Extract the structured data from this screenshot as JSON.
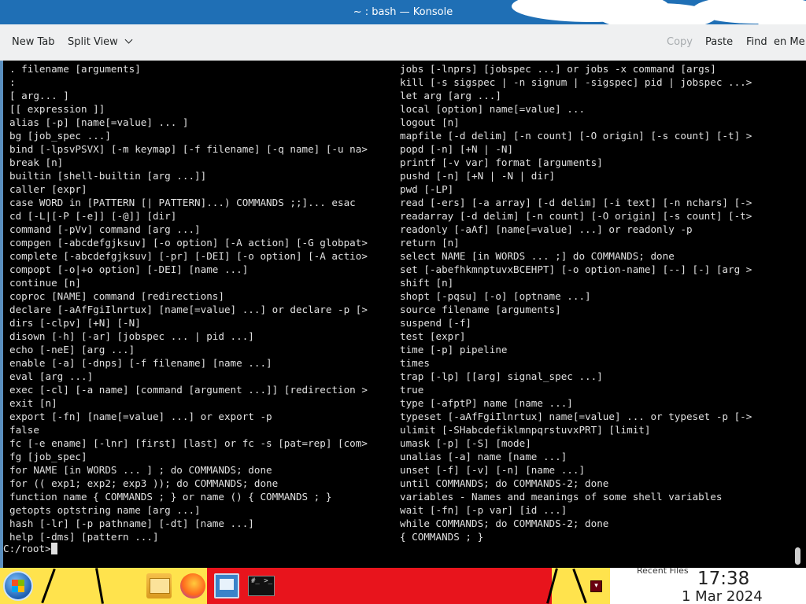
{
  "window": {
    "title": "~ : bash — Konsole"
  },
  "toolbar": {
    "new_tab": "New Tab",
    "split_view": "Split View",
    "copy": "Copy",
    "paste": "Paste",
    "find": "Find",
    "more": "en Me"
  },
  "terminal": {
    "left_column": [
      ". filename [arguments]",
      ":",
      "[ arg... ]",
      "[[ expression ]]",
      "alias [-p] [name[=value] ... ]",
      "bg [job_spec ...]",
      "bind [-lpsvPSVX] [-m keymap] [-f filename] [-q name] [-u na>",
      "break [n]",
      "builtin [shell-builtin [arg ...]]",
      "caller [expr]",
      "case WORD in [PATTERN [| PATTERN]...) COMMANDS ;;]... esac",
      "cd [-L|[-P [-e]] [-@]] [dir]",
      "command [-pVv] command [arg ...]",
      "compgen [-abcdefgjksuv] [-o option] [-A action] [-G globpat>",
      "complete [-abcdefgjksuv] [-pr] [-DEI] [-o option] [-A actio>",
      "compopt [-o|+o option] [-DEI] [name ...]",
      "continue [n]",
      "coproc [NAME] command [redirections]",
      "declare [-aAfFgiIlnrtux] [name[=value] ...] or declare -p [>",
      "dirs [-clpv] [+N] [-N]",
      "disown [-h] [-ar] [jobspec ... | pid ...]",
      "echo [-neE] [arg ...]",
      "enable [-a] [-dnps] [-f filename] [name ...]",
      "eval [arg ...]",
      "exec [-cl] [-a name] [command [argument ...]] [redirection >",
      "exit [n]",
      "export [-fn] [name[=value] ...] or export -p",
      "false",
      "fc [-e ename] [-lnr] [first] [last] or fc -s [pat=rep] [com>",
      "fg [job_spec]",
      "for NAME [in WORDS ... ] ; do COMMANDS; done",
      "for (( exp1; exp2; exp3 )); do COMMANDS; done",
      "function name { COMMANDS ; } or name () { COMMANDS ; }",
      "getopts optstring name [arg ...]",
      "hash [-lr] [-p pathname] [-dt] [name ...]",
      "help [-dms] [pattern ...]"
    ],
    "right_column": [
      "jobs [-lnprs] [jobspec ...] or jobs -x command [args]",
      "kill [-s sigspec | -n signum | -sigspec] pid | jobspec ...>",
      "let arg [arg ...]",
      "local [option] name[=value] ...",
      "logout [n]",
      "mapfile [-d delim] [-n count] [-O origin] [-s count] [-t] >",
      "popd [-n] [+N | -N]",
      "printf [-v var] format [arguments]",
      "pushd [-n] [+N | -N | dir]",
      "pwd [-LP]",
      "read [-ers] [-a array] [-d delim] [-i text] [-n nchars] [->",
      "readarray [-d delim] [-n count] [-O origin] [-s count] [-t>",
      "readonly [-aAf] [name[=value] ...] or readonly -p",
      "return [n]",
      "select NAME [in WORDS ... ;] do COMMANDS; done",
      "set [-abefhkmnptuvxBCEHPT] [-o option-name] [--] [-] [arg >",
      "shift [n]",
      "shopt [-pqsu] [-o] [optname ...]",
      "source filename [arguments]",
      "suspend [-f]",
      "test [expr]",
      "time [-p] pipeline",
      "times",
      "trap [-lp] [[arg] signal_spec ...]",
      "true",
      "type [-afptP] name [name ...]",
      "typeset [-aAfFgiIlnrtux] name[=value] ... or typeset -p [->",
      "ulimit [-SHabcdefiklmnpqrstuvxPRT] [limit]",
      "umask [-p] [-S] [mode]",
      "unalias [-a] name [name ...]",
      "unset [-f] [-v] [-n] [name ...]",
      "until COMMANDS; do COMMANDS-2; done",
      "variables - Names and meanings of some shell variables",
      "wait [-fn] [-p var] [id ...]",
      "while COMMANDS; do COMMANDS-2; done",
      "{ COMMANDS ; }"
    ],
    "prompt": "C:/root>"
  },
  "taskbar": {
    "apps": [
      "start-menu-icon",
      "file-manager-icon",
      "firefox-icon",
      "system-settings-icon",
      "terminal-icon"
    ],
    "terminal_icon_text": "#_ >_",
    "recent_files": "Recent Files",
    "time": "17:38",
    "date": "1 Mar 2024"
  },
  "colors": {
    "terminal_bg": "#000000",
    "terminal_fg": "#e0e0e0",
    "toolbar_bg": "#eff0f1",
    "title_bg": "#1f6fb5",
    "taskbar_yellow": "#ffe34d",
    "taskbar_red": "#e8141c"
  }
}
